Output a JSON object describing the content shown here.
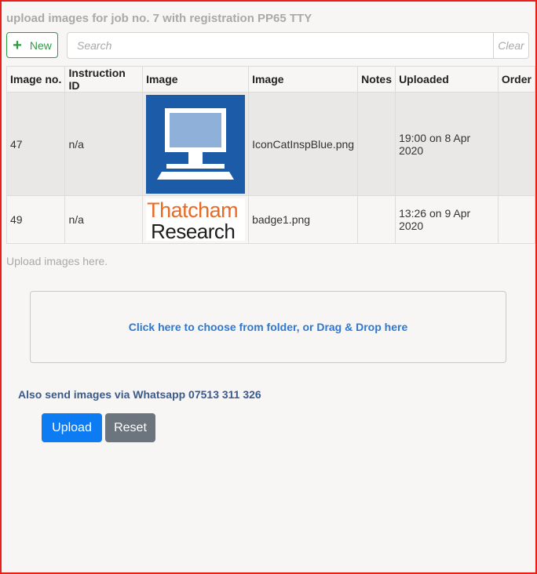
{
  "page": {
    "title": "upload images for job no. 7 with registration PP65 TTY"
  },
  "toolbar": {
    "new_icon": "plus-icon",
    "new_label": "New",
    "search_placeholder": "Search",
    "clear_label": "Clear"
  },
  "table": {
    "headers": [
      "Image no.",
      "Instruction ID",
      "Image",
      "Image",
      "Notes",
      "Uploaded",
      "Order"
    ],
    "rows": [
      {
        "image_no": "47",
        "instruction_id": "n/a",
        "thumbnail_icon": "computer-monitor-icon",
        "filename": "IconCatInspBlue.png",
        "notes": "",
        "uploaded": "19:00 on 8 Apr 2020",
        "order": ""
      },
      {
        "image_no": "49",
        "instruction_id": "n/a",
        "thumbnail_logo_line1": "Thatcham",
        "thumbnail_logo_line2": "Research",
        "filename": "badge1.png",
        "notes": "",
        "uploaded": "13:26 on 9 Apr 2020",
        "order": ""
      }
    ]
  },
  "upload": {
    "section_label": "Upload images here.",
    "dropzone_text": "Click here to choose from folder, or Drag & Drop here",
    "whatsapp_text": "Also send images via Whatsapp 07513 311 326",
    "upload_button": "Upload",
    "reset_button": "Reset"
  },
  "colors": {
    "frame_border": "#e8201c",
    "new_button": "#2e9b42",
    "upload_button": "#0d7bf2",
    "reset_button": "#6c757d",
    "link_blue": "#2f78d0",
    "thumbnail_blue": "#1c5ba8",
    "thatcham_orange": "#e86a24"
  }
}
